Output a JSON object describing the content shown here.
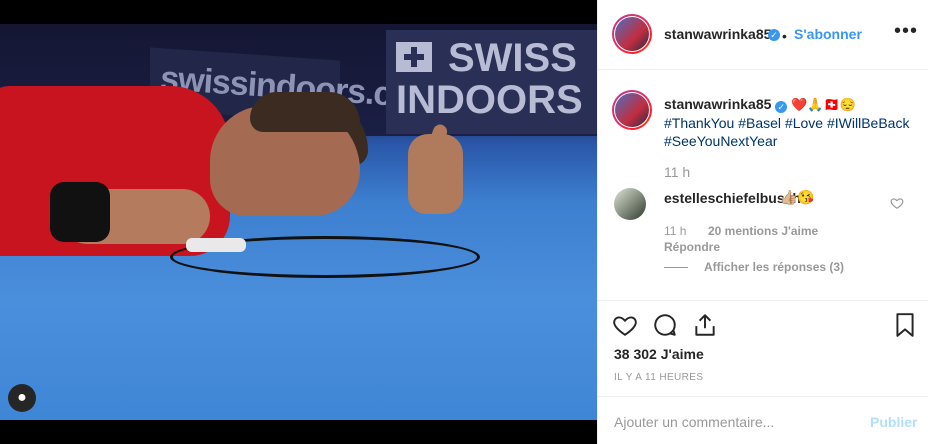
{
  "photo": {
    "banner_left_text": "swissindoors.ch",
    "banner_right_line1": "SWISS",
    "banner_right_line2": "INDOORS"
  },
  "post": {
    "username": "stanwawrinka85",
    "follow_label": "S'abonner",
    "more_label": "•••",
    "verified_mark": "✓"
  },
  "caption": {
    "username": "stanwawrinka85",
    "emojis": "❤️🙏🇨🇭😔",
    "hashtags": [
      "#ThankYou",
      "#Basel",
      "#Love",
      "#IWillBeBack",
      "#SeeYouNextYear"
    ],
    "time": "11 h"
  },
  "comment": {
    "username": "estelleschiefelbusch",
    "text": "👍🏼😘",
    "time": "11 h",
    "likes": "20 mentions J'aime",
    "reply_label": "Répondre",
    "view_replies": "Afficher les réponses (3)"
  },
  "engagement": {
    "likes": "38 302 J'aime",
    "posted": "IL Y A 11 HEURES"
  },
  "composer": {
    "placeholder": "Ajouter un commentaire...",
    "publish_label": "Publier"
  }
}
